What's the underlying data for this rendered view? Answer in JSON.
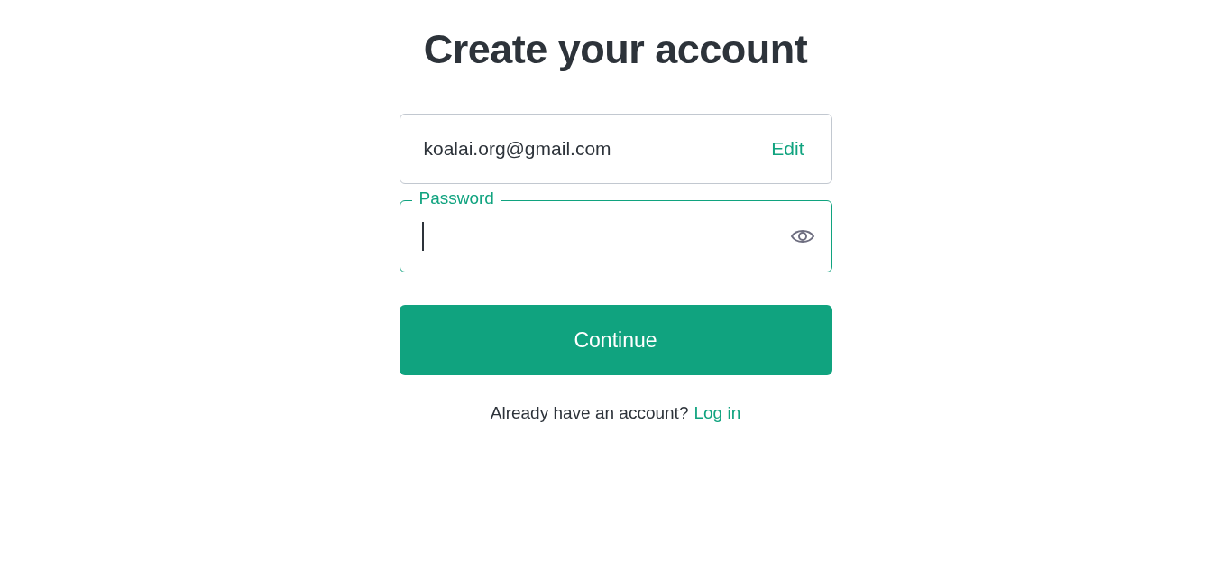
{
  "title": "Create your account",
  "email_field": {
    "value": "koalai.org@gmail.com",
    "edit_link": "Edit"
  },
  "password_field": {
    "label": "Password",
    "focused": true
  },
  "continue_button": "Continue",
  "login_prompt": {
    "text": "Already have an account?",
    "link": "Log in"
  }
}
